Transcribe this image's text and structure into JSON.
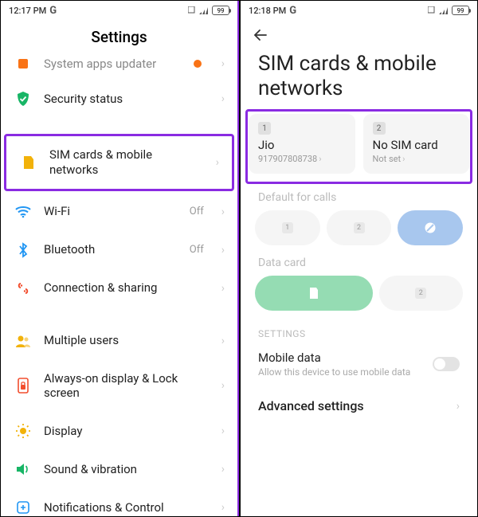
{
  "left": {
    "status": {
      "time": "12:17 PM",
      "battery": "99"
    },
    "title": "Settings",
    "rows": {
      "system_apps": {
        "label": "System apps updater"
      },
      "security": {
        "label": "Security status"
      },
      "sim": {
        "label": "SIM cards & mobile networks"
      },
      "wifi": {
        "label": "Wi-Fi",
        "value": "Off"
      },
      "bluetooth": {
        "label": "Bluetooth",
        "value": "Off"
      },
      "connection": {
        "label": "Connection & sharing"
      },
      "multiple_users": {
        "label": "Multiple users"
      },
      "aod": {
        "label": "Always-on display & Lock screen"
      },
      "display": {
        "label": "Display"
      },
      "sound": {
        "label": "Sound & vibration"
      },
      "notifications": {
        "label": "Notifications & Control"
      }
    }
  },
  "right": {
    "status": {
      "time": "12:18 PM",
      "battery": "99"
    },
    "title": "SIM cards & mobile networks",
    "sim1": {
      "badge": "1",
      "name": "Jio",
      "number": "917907808738"
    },
    "sim2": {
      "badge": "2",
      "name": "No SIM card",
      "status": "Not set"
    },
    "default_calls_label": "Default for calls",
    "calls_opt1": "1",
    "calls_opt2": "2",
    "data_card_label": "Data card",
    "data_opt2": "2",
    "settings_header": "SETTINGS",
    "mobile_data": {
      "title": "Mobile data",
      "desc": "Allow this device to use mobile data"
    },
    "advanced": "Advanced settings"
  }
}
